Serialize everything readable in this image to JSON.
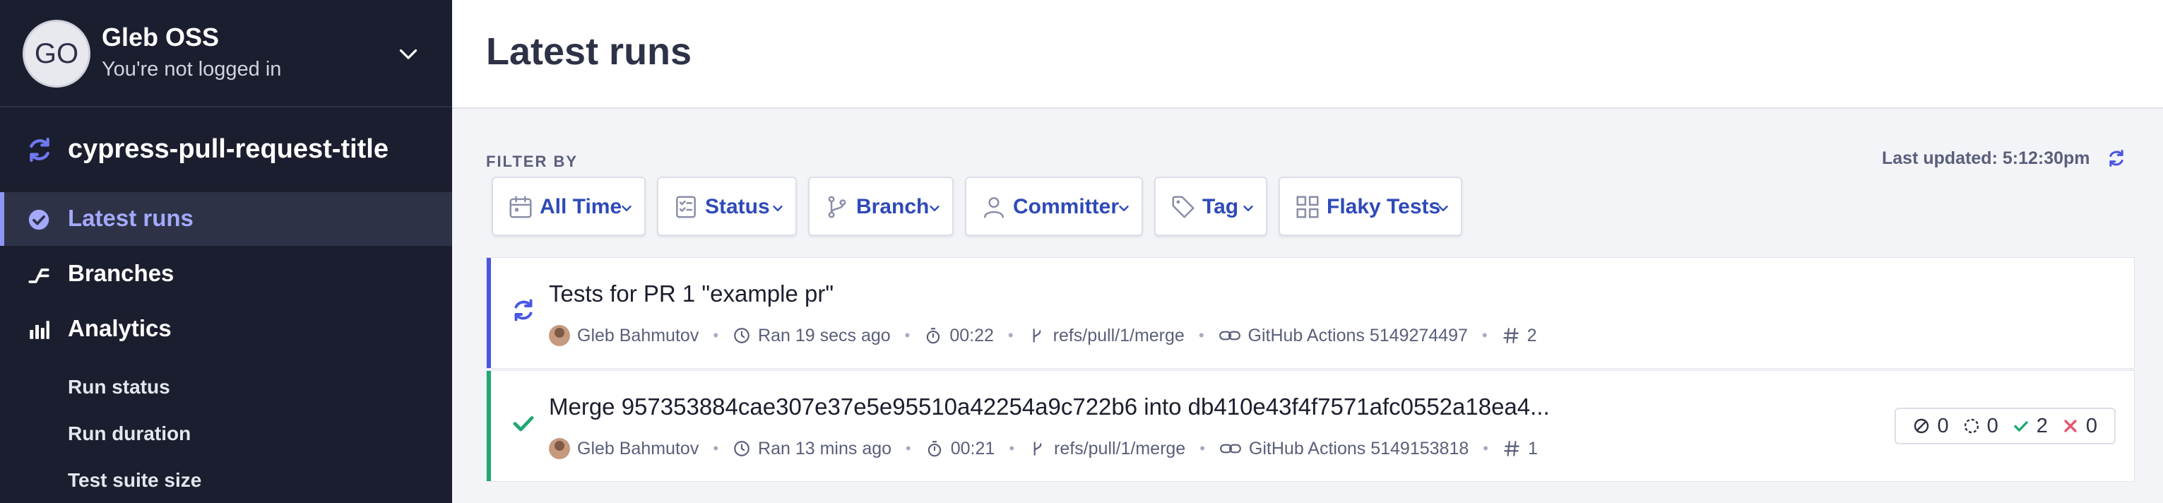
{
  "org": {
    "initials": "GO",
    "name": "Gleb OSS",
    "subtitle": "You're not logged in"
  },
  "project": {
    "name": "cypress-pull-request-title"
  },
  "nav": {
    "items": [
      {
        "label": "Latest runs",
        "icon": "check-circle-icon",
        "active": true
      },
      {
        "label": "Branches",
        "icon": "branch-icon",
        "active": false
      },
      {
        "label": "Analytics",
        "icon": "bar-chart-icon",
        "active": false
      }
    ],
    "analytics_sub": [
      "Run status",
      "Run duration",
      "Test suite size"
    ]
  },
  "main": {
    "title": "Latest runs",
    "filter_label": "FILTER BY",
    "last_updated": "Last updated: 5:12:30pm",
    "filters": [
      {
        "label": "All Time",
        "icon": "calendar-icon"
      },
      {
        "label": "Status",
        "icon": "checklist-icon"
      },
      {
        "label": "Branch",
        "icon": "git-branch-icon"
      },
      {
        "label": "Committer",
        "icon": "user-icon"
      },
      {
        "label": "Tag",
        "icon": "tag-icon"
      },
      {
        "label": "Flaky Tests",
        "icon": "grid-icon"
      }
    ]
  },
  "runs": [
    {
      "status": "running",
      "status_color": "#4956e3",
      "title": "Tests for PR 1 \"example pr\"",
      "committer": "Gleb Bahmutov",
      "time": "Ran 19 secs ago",
      "duration": "00:22",
      "branch": "refs/pull/1/merge",
      "ci": "GitHub Actions 5149274497",
      "number": "2",
      "results": null
    },
    {
      "status": "passed",
      "status_color": "#1fa971",
      "title": "Merge 957353884cae307e37e5e95510a42254a9c722b6 into db410e43f4f7571afc0552a18ea4...",
      "committer": "Gleb Bahmutov",
      "time": "Ran 13 mins ago",
      "duration": "00:21",
      "branch": "refs/pull/1/merge",
      "ci": "GitHub Actions 5149153818",
      "number": "1",
      "results": {
        "skipped": "0",
        "pending": "0",
        "passed": "2",
        "failed": "0"
      }
    }
  ],
  "colors": {
    "sidebar_bg": "#1b1e2e",
    "accent": "#4956e3",
    "link": "#2e4ab8",
    "pass": "#1fa971",
    "fail": "#e45770"
  }
}
